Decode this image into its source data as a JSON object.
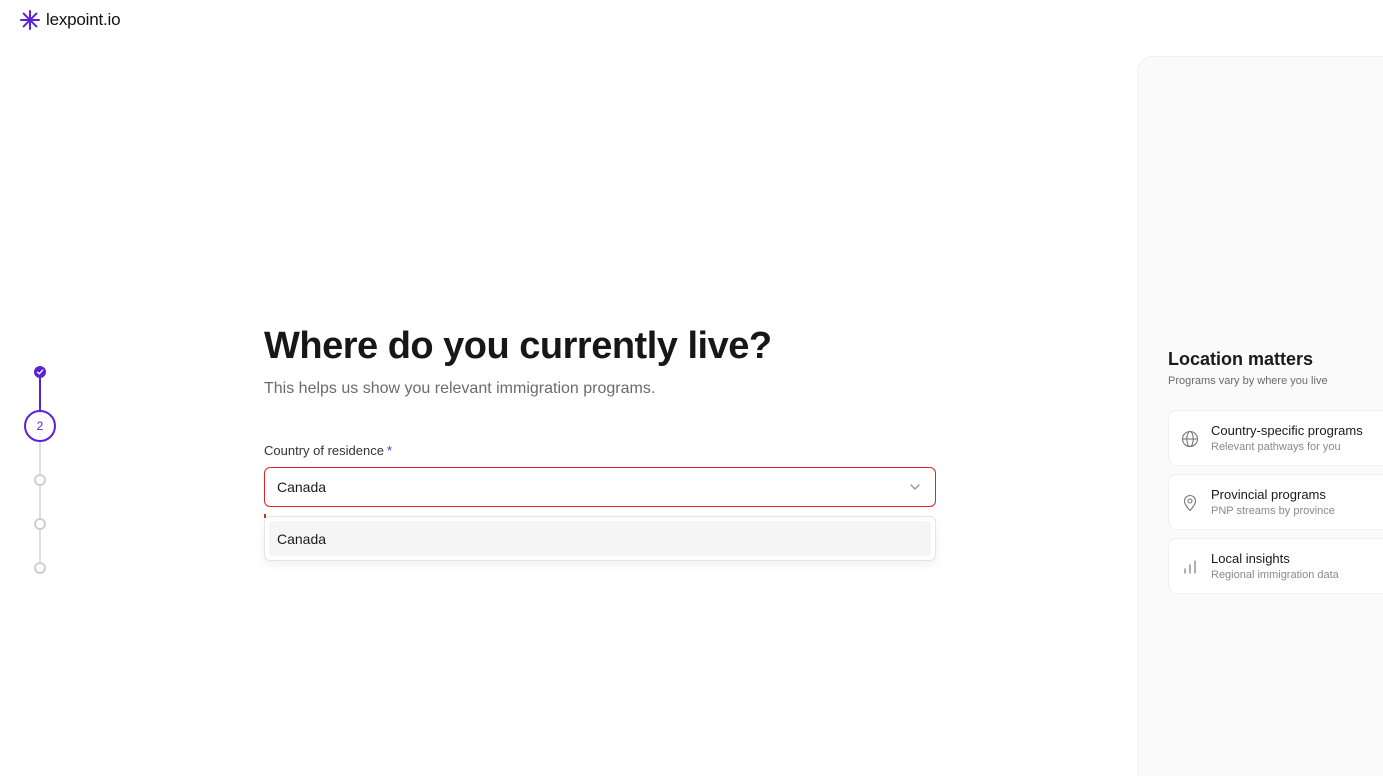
{
  "brand": {
    "name": "lexpoint.io",
    "color": "#5b21d6"
  },
  "stepper": {
    "current_step": "2",
    "total_steps": 5,
    "completed": 1
  },
  "question": {
    "title": "Where do you currently live?",
    "subtitle": "This helps us show you relevant immigration programs."
  },
  "field": {
    "label": "Country of residence",
    "required_mark": "*",
    "value": "Canada",
    "state": "error",
    "options": [
      "Canada"
    ]
  },
  "side_panel": {
    "title": "Location matters",
    "subtitle": "Programs vary by where you live",
    "cards": [
      {
        "icon": "globe-icon",
        "title": "Country-specific programs",
        "subtitle": "Relevant pathways for you"
      },
      {
        "icon": "map-pin-icon",
        "title": "Provincial programs",
        "subtitle": "PNP streams by province"
      },
      {
        "icon": "bar-chart-icon",
        "title": "Local insights",
        "subtitle": "Regional immigration data"
      }
    ]
  }
}
